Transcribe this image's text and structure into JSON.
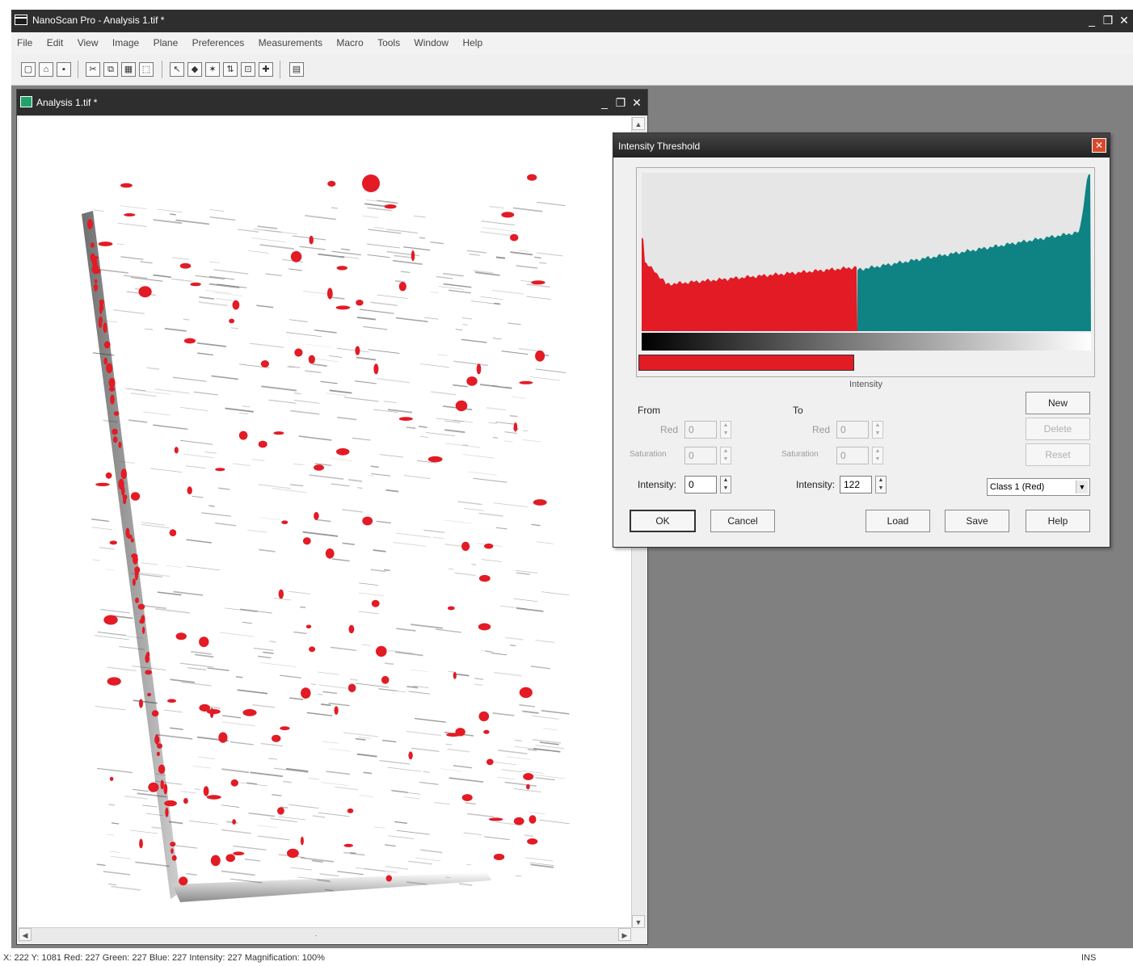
{
  "app": {
    "title": "NanoScan Pro - Analysis 1.tif *",
    "window_controls": [
      "_",
      "❐",
      "✕"
    ]
  },
  "menu": [
    "File",
    "Edit",
    "View",
    "Image",
    "Plane",
    "Preferences",
    "Measurements",
    "Macro",
    "Tools",
    "Window",
    "Help"
  ],
  "toolbar": {
    "buttons": [
      {
        "name": "new-icon",
        "glyph": "▢"
      },
      {
        "name": "open-icon",
        "glyph": "⌂"
      },
      {
        "name": "save-icon",
        "glyph": "▪"
      },
      {
        "name": "cut-icon",
        "glyph": "✂"
      },
      {
        "name": "copy-icon",
        "glyph": "⧉"
      },
      {
        "name": "image-icon",
        "glyph": "▦"
      },
      {
        "name": "region-icon",
        "glyph": "⬚"
      },
      {
        "name": "pointer-icon",
        "glyph": "↖"
      },
      {
        "name": "threshold-icon",
        "glyph": "◆"
      },
      {
        "name": "wand-icon",
        "glyph": "✶"
      },
      {
        "name": "filter-icon",
        "glyph": "⇅"
      },
      {
        "name": "crop-icon",
        "glyph": "⊡"
      },
      {
        "name": "measure-icon",
        "glyph": "✚"
      },
      {
        "name": "print-icon",
        "glyph": "▤"
      }
    ]
  },
  "document": {
    "title": "Analysis 1.tif *",
    "controls": [
      "_",
      "❐",
      "✕"
    ]
  },
  "dialog": {
    "title": "Intensity Threshold",
    "close_glyph": "✕",
    "histogram_caption": "Intensity",
    "from_label": "From",
    "to_label": "To",
    "from": {
      "row1_label": "Red",
      "row1_value": "0",
      "row2_label": "Saturation",
      "row2_value": "0",
      "intensity_label": "Intensity:",
      "intensity_value": "0"
    },
    "to": {
      "row1_label": "Red",
      "row1_value": "0",
      "row2_label": "Saturation",
      "row2_value": "0",
      "intensity_label": "Intensity:",
      "intensity_value": "122"
    },
    "side_buttons": [
      "New",
      "Delete",
      "Reset"
    ],
    "channel_select": "Class 1 (Red)",
    "buttons": {
      "ok": "OK",
      "cancel": "Cancel",
      "load": "Load",
      "save": "Save",
      "help": "Help"
    },
    "threshold_fraction": 0.48,
    "colors": {
      "selected": "#e21b25",
      "unselected": "#0f8383",
      "background": "#e6e6e6"
    }
  },
  "status": {
    "coords": "X: 222  Y: 1081  Red: 227  Green: 227  Blue: 227  Intensity: 227  Magnification: 100%",
    "mode": "INS"
  },
  "colors": {
    "title_bar": "#2e2e2e",
    "workspace": "#808080",
    "highlight": "#e21b25"
  }
}
